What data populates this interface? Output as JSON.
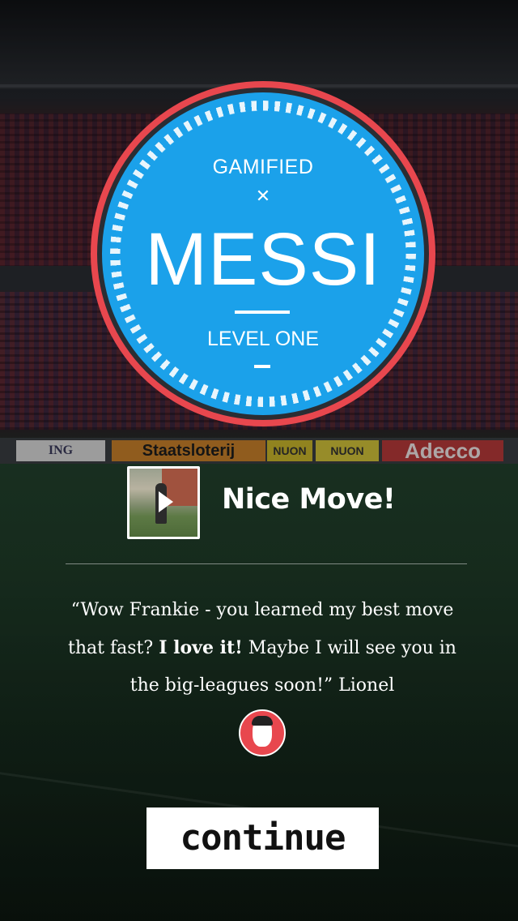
{
  "badge": {
    "top_label": "GAMIFIED",
    "star_glyph": "✕",
    "title": "MESSI",
    "level": "LEVEL ONE",
    "colors": {
      "ring": "#e8474e",
      "fill": "#1ba1ea"
    }
  },
  "stadium_ads": [
    "ING",
    "Staatsloterij",
    "NUON",
    "NUON",
    "Adecco"
  ],
  "result": {
    "heading": "Nice Move!",
    "video_thumbnail_icon": "play-icon"
  },
  "quote": {
    "open": "“Wow Frankie - you learned my best move that fast? ",
    "emphasis": "I love it!",
    "close": " Maybe I will see you in the big-leagues soon!” Lionel"
  },
  "avatar": {
    "icon": "messi-avatar-icon"
  },
  "actions": {
    "continue_label": "continue"
  }
}
